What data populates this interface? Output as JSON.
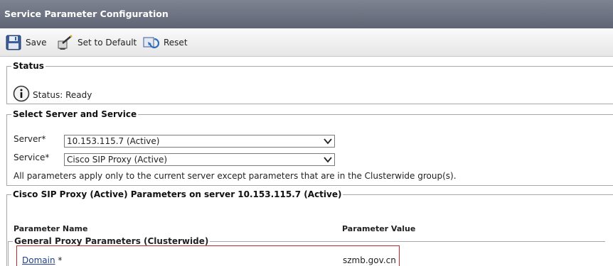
{
  "title": "Service Parameter Configuration",
  "toolbar": {
    "save_label": "Save",
    "set_default_label": "Set to Default",
    "reset_label": "Reset"
  },
  "status": {
    "legend": "Status",
    "text": "Status: Ready"
  },
  "server_service": {
    "legend": "Select Server and Service",
    "server_label": "Server",
    "server_value": "10.153.115.7 (Active)",
    "service_label": "Service",
    "service_value": "Cisco SIP Proxy (Active)",
    "required_mark": "*",
    "note": "All parameters apply only to the current server except parameters that are in the Clusterwide group(s)."
  },
  "parameters": {
    "legend": "Cisco SIP Proxy (Active) Parameters on server 10.153.115.7 (Active)",
    "col_name": "Parameter Name",
    "col_value": "Parameter Value",
    "group_legend": "General Proxy Parameters (Clusterwide)",
    "rows": [
      {
        "name": "Domain",
        "required_mark": "*",
        "value": "szmb.gov.cn"
      }
    ]
  },
  "colors": {
    "titlebar": "#6b7180",
    "highlight_border": "#c0282d",
    "link": "#1e3f8a"
  },
  "icons": {
    "save": "floppy-disk-icon",
    "set_default": "wand-stamp-icon",
    "reset": "reset-icon",
    "status": "info-icon",
    "dropdown": "chevron-down-icon"
  }
}
